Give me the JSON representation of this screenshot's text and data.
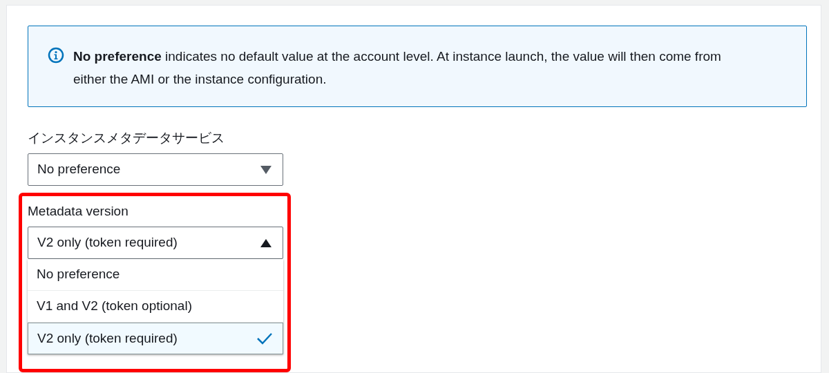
{
  "info_alert": {
    "text": "**No preference** indicates no default value at the account level. At instance launch, the value will then come from either the AMI or the instance configuration."
  },
  "fields": [
    {
      "label": "インスタンスメタデータサービス",
      "value": "No preference",
      "expanded": false,
      "highlighted": false
    },
    {
      "label": "Metadata version",
      "value": "V2 only (token required)",
      "expanded": true,
      "highlighted": true,
      "options": [
        {
          "label": "No preference",
          "selected": false
        },
        {
          "label": "V1 and V2 (token optional)",
          "selected": false
        },
        {
          "label": "V2 only (token required)",
          "selected": true
        }
      ]
    }
  ]
}
